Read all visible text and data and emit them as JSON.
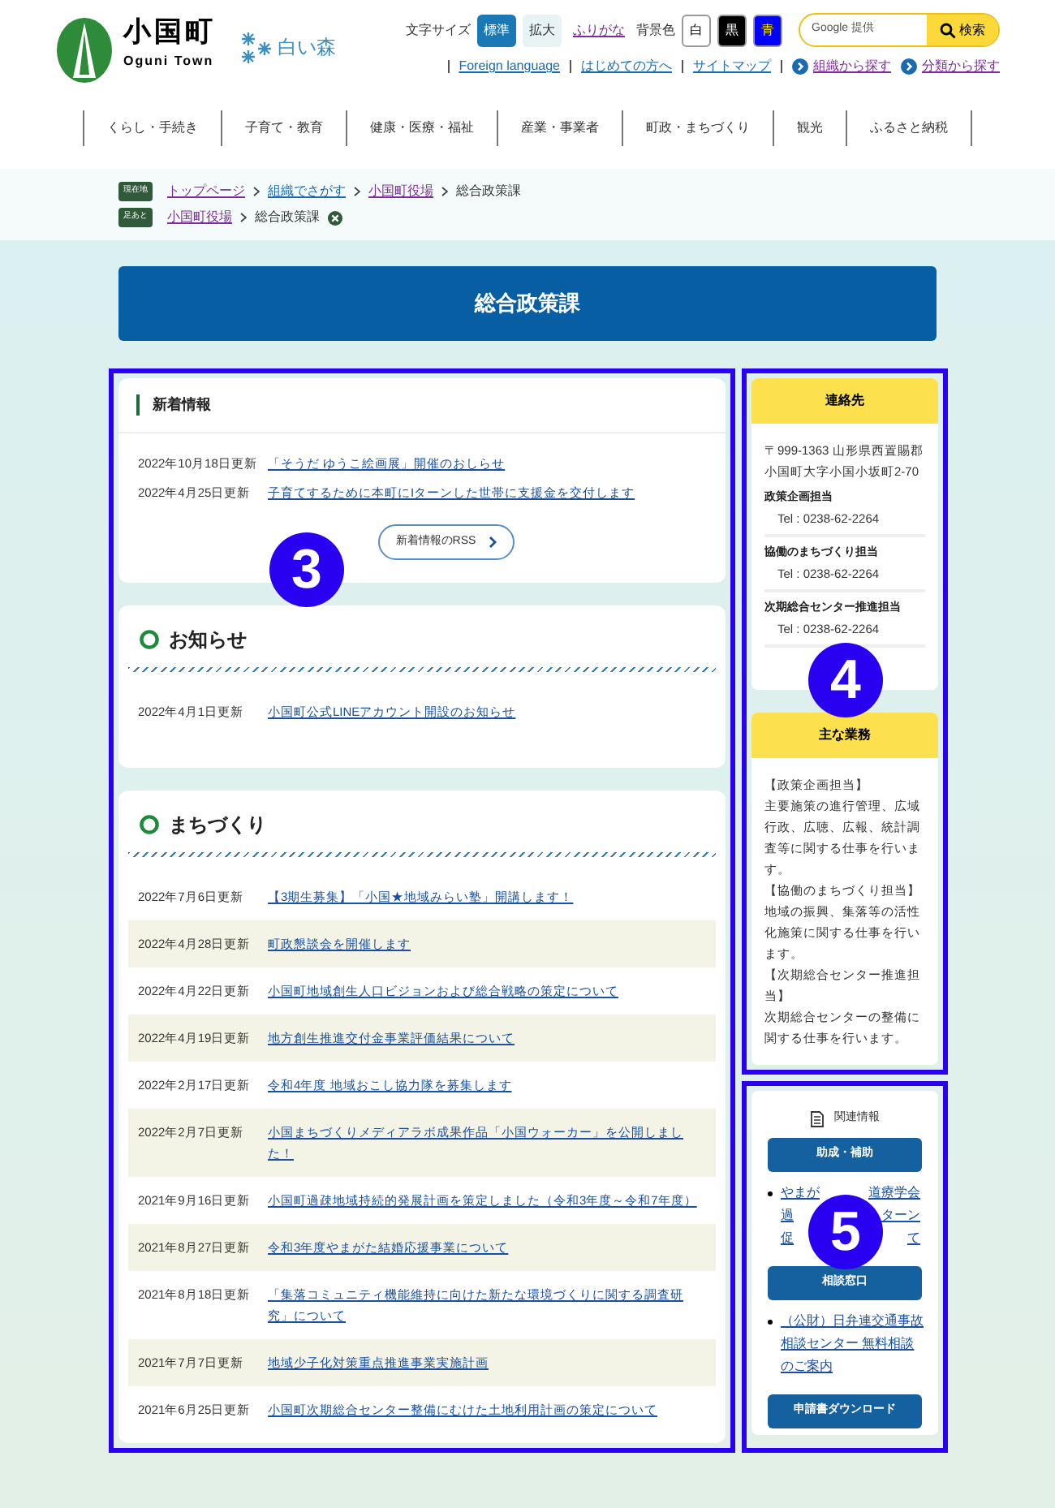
{
  "header": {
    "logo_title": "小国町",
    "logo_subtitle": "Oguni Town",
    "brand_logo": "白い森",
    "text_size": {
      "label": "文字サイズ",
      "options": [
        {
          "label": "標準",
          "selected": true
        },
        {
          "label": "拡大",
          "selected": false
        }
      ]
    },
    "furigana": "ふりがな",
    "bg_color": {
      "label": "背景色",
      "options": [
        {
          "label": "白",
          "color": "#ffffff"
        },
        {
          "label": "黒",
          "color": "#000000"
        },
        {
          "label": "青",
          "color": "#0000ff"
        }
      ]
    },
    "search": {
      "placeholder": "Google 提供",
      "button": "検索"
    },
    "links": [
      {
        "label": "Foreign language",
        "kind": "plain"
      },
      {
        "label": "はじめての方へ",
        "kind": "plain"
      },
      {
        "label": "サイトマップ",
        "kind": "plain"
      },
      {
        "label": "組織から探す",
        "kind": "arrow"
      },
      {
        "label": "分類から探す",
        "kind": "arrow"
      }
    ]
  },
  "nav": [
    "くらし・手続き",
    "子育て・教育",
    "健康・医療・福祉",
    "産業・事業者",
    "町政・まちづくり",
    "観光",
    "ふるさと納税"
  ],
  "breadcrumbs": [
    {
      "badge": "現在地",
      "items": [
        "トップページ",
        "組織でさがす",
        "小国町役場"
      ],
      "current": "総合政策課"
    },
    {
      "badge": "足あと",
      "items": [
        "小国町役場"
      ],
      "current": "総合政策課",
      "closable": true
    }
  ],
  "page_title": "総合政策課",
  "news": {
    "title": "新着情報",
    "marker": "3",
    "items": [
      {
        "date": "2022年10月18日更新",
        "title": "「そうだ ゆうこ絵画展」開催のおしらせ"
      },
      {
        "date": "2022年4月25日更新",
        "title": "子育てするために本町にIターンした世帯に支援金を交付します"
      }
    ],
    "rss_button": "新着情報のRSS"
  },
  "sections": [
    {
      "title": "お知らせ",
      "items": [
        {
          "date": "2022年4月1日更新",
          "title": "小国町公式LINEアカウント開設のお知らせ"
        }
      ]
    },
    {
      "title": "まちづくり",
      "items": [
        {
          "date": "2022年7月6日更新",
          "title": "【3期生募集】「小国★地域みらい塾」開講します！"
        },
        {
          "date": "2022年4月28日更新",
          "title": "町政懇談会を開催します"
        },
        {
          "date": "2022年4月22日更新",
          "title": "小国町地域創生人口ビジョンおよび総合戦略の策定について"
        },
        {
          "date": "2022年4月19日更新",
          "title": "地方創生推進交付金事業評価結果について"
        },
        {
          "date": "2022年2月17日更新",
          "title": "令和4年度 地域おこし協力隊を募集します"
        },
        {
          "date": "2022年2月7日更新",
          "title": "小国まちづくりメディアラボ成果作品「小国ウォーカー」を公開しました！"
        },
        {
          "date": "2021年9月16日更新",
          "title": "小国町過疎地域持続的発展計画を策定しました（令和3年度～令和7年度）"
        },
        {
          "date": "2021年8月27日更新",
          "title": "令和3年度やまがた結婚応援事業について"
        },
        {
          "date": "2021年8月18日更新",
          "title": "「集落コミュニティ機能維持に向けた新たな環境づくりに関する調査研究」について"
        },
        {
          "date": "2021年7月7日更新",
          "title": "地域少子化対策重点推進事業実施計画"
        },
        {
          "date": "2021年6月25日更新",
          "title": "小国町次期総合センター整備にむけた土地利用計画の策定について"
        }
      ]
    }
  ],
  "sidebar": {
    "marker": "4",
    "contact": {
      "title": "連絡先",
      "address": "〒999-1363 山形県西置賜郡小国町大字小国小坂町2-70",
      "departments": [
        {
          "name": "政策企画担当",
          "tel": "Tel : 0238-62-2264"
        },
        {
          "name": "協働のまちづくり担当",
          "tel": "Tel : 0238-62-2264"
        },
        {
          "name": "次期総合センター推進担当",
          "tel": "Tel : 0238-62-2264"
        }
      ]
    },
    "duties": {
      "title": "主な業務",
      "paragraphs": [
        {
          "heading": "【政策企画担当】",
          "text": "主要施策の進行管理、広域行政、広聴、広報、統計調査等に関する仕事を行います。"
        },
        {
          "heading": "【協働のまちづくり担当】",
          "text": "地域の振興、集落等の活性化施策に関する仕事を行います。"
        },
        {
          "heading": "【次期総合センター推進担当】",
          "text": "次期総合センターの整備に関する仕事を行います。"
        }
      ]
    },
    "related": {
      "title": "関連情報",
      "marker": "5",
      "groups": [
        {
          "button": "助成・補助",
          "links": [
            {
              "lines": [
                [
                  "やまが",
                  "道療学会"
                ],
                [
                  "過",
                  "ターン"
                ],
                [
                  "促",
                  "て"
                ]
              ]
            }
          ]
        },
        {
          "button": "相談窓口",
          "links": [
            {
              "lines": [
                [
                  "（公財）日弁連交通事故"
                ],
                [
                  "相談センター 無料相談"
                ],
                [
                  "のご案内"
                ]
              ]
            }
          ]
        },
        {
          "button": "申請書ダウンロード"
        }
      ]
    }
  }
}
